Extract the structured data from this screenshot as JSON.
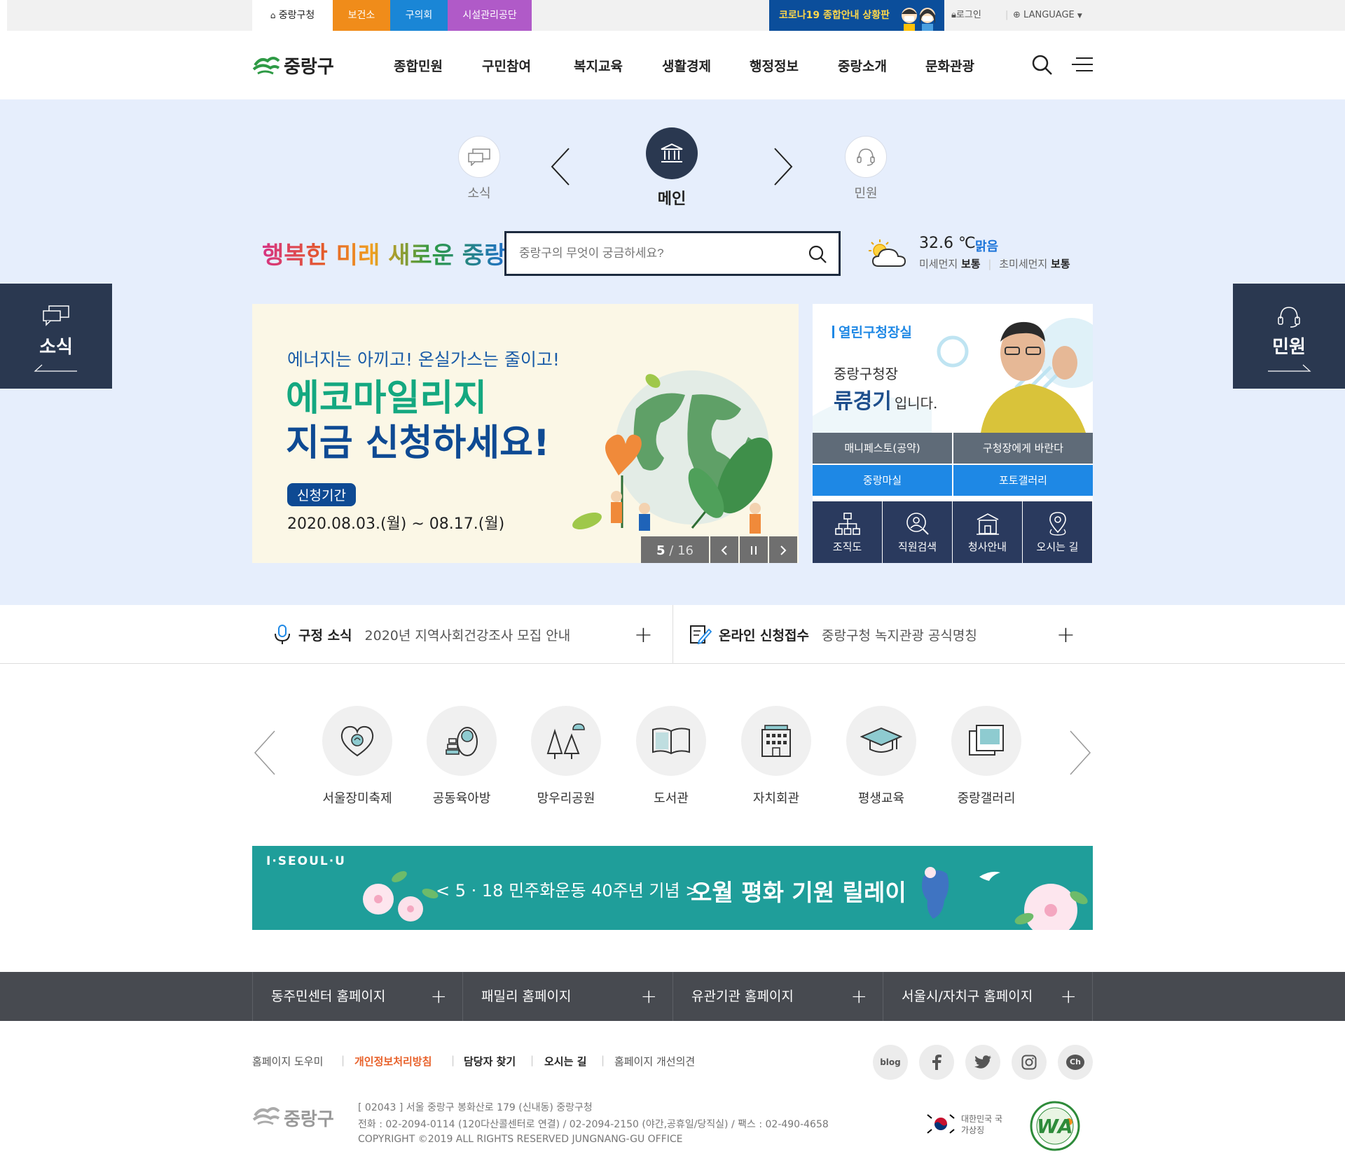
{
  "top_tabs": [
    {
      "label": "중랑구청",
      "color": "#ffffff",
      "text_color": "#222222"
    },
    {
      "label": "보건소",
      "color": "#f08c1a"
    },
    {
      "label": "구의회",
      "color": "#1a86d6"
    },
    {
      "label": "시설관리공단",
      "color": "#b05ac8"
    }
  ],
  "corona_label": "코로나19 종합안내 상황판",
  "util": {
    "login": "로그인",
    "language": "LANGUAGE"
  },
  "header": {
    "logo": "중랑구",
    "gnb": [
      "종합민원",
      "구민참여",
      "복지교육",
      "생활경제",
      "행정정보",
      "중랑소개",
      "문화관광"
    ]
  },
  "categories": {
    "left": "소식",
    "center": "메인",
    "right": "민원"
  },
  "slogan": "행복한 미래 새로운 중랑",
  "search": {
    "placeholder": "중랑구의 무엇이 궁금하세요?"
  },
  "weather": {
    "temp": "32.6 ℃",
    "condition": "맑음",
    "fine_dust_label": "미세먼지",
    "fine_dust_value": "보통",
    "ultra_dust_label": "초미세먼지",
    "ultra_dust_value": "보통"
  },
  "side_tabs": {
    "left": "소식",
    "right": "민원"
  },
  "banner": {
    "line1": "에너지는 아끼고! 온실가스는 줄이고!",
    "line2": "에코마일리지",
    "line3": "지금 신청하세요!",
    "period_tag": "신청기간",
    "period": "2020.08.03.(월) ~ 08.17.(월)",
    "page_current": "5",
    "page_total": "/ 16"
  },
  "mayor": {
    "title": "열린구청장실",
    "intro": "중랑구청장",
    "name": "류경기",
    "suffix": "입니다.",
    "buttons": [
      "매니페스토(공약)",
      "구청장에게 바란다",
      "중랑마실",
      "포토갤러리"
    ],
    "quick": [
      "조직도",
      "직원검색",
      "청사안내",
      "오시는 길"
    ]
  },
  "news": [
    {
      "title": "구정 소식",
      "text": "2020년 지역사회건강조사 모집 안내"
    },
    {
      "title": "온라인 신청접수",
      "text": "중랑구청 녹지관광 공식명칭"
    }
  ],
  "services": [
    "서울장미축제",
    "공동육아방",
    "망우리공원",
    "도서관",
    "자치회관",
    "평생교육",
    "중랑갤러리"
  ],
  "seoul_banner": {
    "brand": "I·SEOUL·U",
    "subtitle": "< 5 · 18 민주화운동 40주년 기념 >",
    "title": "오월 평화 기원 릴레이"
  },
  "related": [
    "동주민센터 홈페이지",
    "패밀리 홈페이지",
    "유관기관 홈페이지",
    "서울시/자치구 홈페이지"
  ],
  "footer": {
    "links": [
      "홈페이지 도우미",
      "개인정보처리방침",
      "담당자 찾기",
      "오시는 길",
      "홈페이지 개선의견"
    ],
    "sns": [
      "blog",
      "f",
      "t",
      "ig",
      "Ch"
    ],
    "logo": "중랑구",
    "address": "[ 02043 ] 서울 중랑구 봉화산로 179 (신내동) 중랑구청",
    "phone": "전화 : 02-2094-0114 (120다산콜센터로 연결)  /  02-2094-2150 (야간,공휴일/당직실)  /  팩스 : 02-490-4658",
    "copyright": "COPYRIGHT ©2019 ALL RIGHTS RESERVED JUNGNANG-GU OFFICE",
    "badge_korea": "대한민국 국가상징",
    "badge_wa": "WA"
  },
  "colors": {
    "hero_bg": "#e6eefc",
    "navy": "#2a3850",
    "blue_btn": "#1e88e5",
    "gray_btn": "#5f6b78",
    "teal": "#1f9e9a"
  }
}
